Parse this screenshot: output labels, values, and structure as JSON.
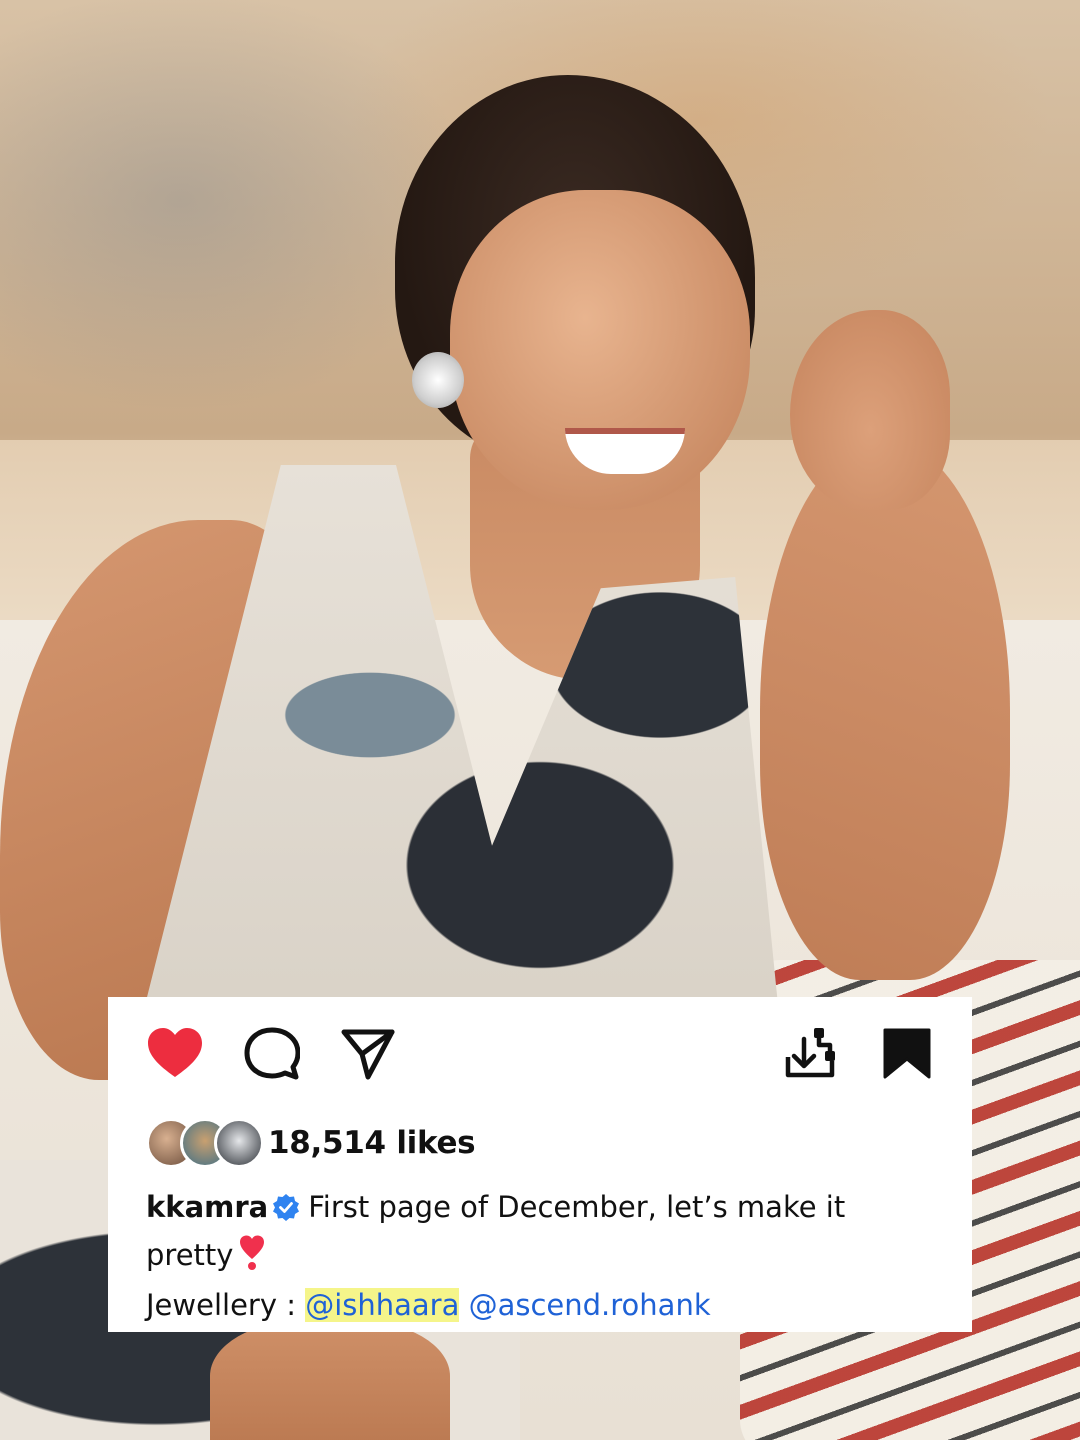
{
  "post": {
    "actions": {
      "like_icon": "heart-filled-icon",
      "comment_icon": "comment-icon",
      "share_icon": "paper-plane-icon",
      "download_icon": "download-icon",
      "save_icon": "bookmark-filled-icon",
      "like_color": "#ed2d3f"
    },
    "likes": {
      "text": "18,514 likes"
    },
    "caption": {
      "username": "kkamra",
      "text": "First page of December, let’s make it pretty",
      "verified_color": "#2f83f0",
      "emoji": "heart-exclamation-emoji",
      "credit_label": "Jewellery :",
      "mentions": [
        "@ishhaara",
        "@ascend.rohank"
      ]
    }
  }
}
